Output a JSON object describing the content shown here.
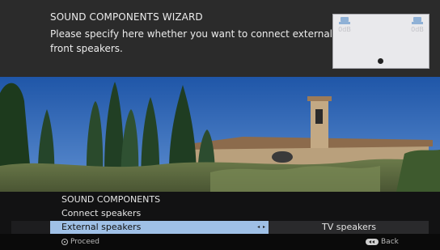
{
  "wizard": {
    "title": "SOUND COMPONENTS WIZARD",
    "description": "Please specify here whether you want to connect external front speakers."
  },
  "diagram": {
    "left_speaker_label": "0dB",
    "right_speaker_label": "0dB",
    "speaker_icon": "speaker-icon",
    "listener_icon": "listener-dot-icon"
  },
  "menu": {
    "section_title": "SOUND COMPONENTS",
    "item_label": "Connect speakers",
    "selected_option": "External speakers",
    "other_option": "TV speakers",
    "selector_arrows": "◂ ▸"
  },
  "footer": {
    "proceed_label": "Proceed",
    "back_label": "Back"
  },
  "colors": {
    "selected_highlight": "#9fc0e6",
    "speaker_icon": "#8fb1d6"
  }
}
